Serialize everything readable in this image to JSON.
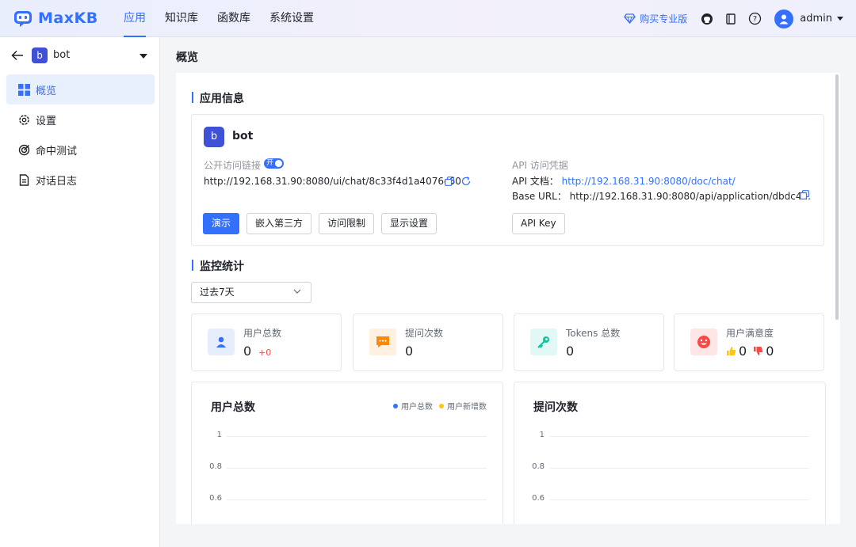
{
  "brand": {
    "name": "MaxKB",
    "color": "#3370ff"
  },
  "nav": {
    "items": [
      "应用",
      "知识库",
      "函数库",
      "系统设置"
    ],
    "active": "应用"
  },
  "header": {
    "buy_label": "购买专业版",
    "user": "admin"
  },
  "sidebar": {
    "app_badge": "b",
    "app_name": "bot",
    "items": [
      {
        "label": "概览",
        "icon": "grid-icon"
      },
      {
        "label": "设置",
        "icon": "gear-icon"
      },
      {
        "label": "命中测试",
        "icon": "target-icon"
      },
      {
        "label": "对话日志",
        "icon": "document-icon"
      }
    ]
  },
  "main": {
    "page_title": "概览",
    "app_info": {
      "section_title": "应用信息",
      "badge": "b",
      "name": "bot",
      "public_link_label": "公开访问链接",
      "toggle_label": "开",
      "public_link": "http://192.168.31.90:8080/ui/chat/8c33f4d1a4076c60",
      "buttons": [
        "演示",
        "嵌入第三方",
        "访问限制",
        "显示设置"
      ],
      "api_title": "API 访问凭据",
      "api_doc_label": "API 文档：",
      "api_doc_url": "http://192.168.31.90:8080/doc/chat/",
      "base_url_label": "Base URL：",
      "base_url": "http://192.168.31.90:8080/api/application/dbdc4...",
      "api_key_button": "API Key"
    },
    "monitor": {
      "section_title": "监控统计",
      "range_select": "过去7天",
      "stats": [
        {
          "label": "用户总数",
          "value": "0",
          "delta": "+0",
          "icon": "user-icon",
          "color": "#3370ff"
        },
        {
          "label": "提问次数",
          "value": "0",
          "icon": "chat-icon",
          "color": "#ff8800"
        },
        {
          "label": "Tokens 总数",
          "value": "0",
          "icon": "key-icon",
          "color": "#14c0a8"
        },
        {
          "label": "用户满意度",
          "likes": "0",
          "dislikes": "0",
          "icon": "smile-icon",
          "color": "#f54a45"
        }
      ]
    },
    "charts": [
      {
        "title": "用户总数",
        "legend": [
          {
            "name": "用户总数",
            "color": "#3370ff"
          },
          {
            "name": "用户新增数",
            "color": "#ffc60a"
          }
        ],
        "ticks": [
          "1",
          "0.8",
          "0.6"
        ]
      },
      {
        "title": "提问次数",
        "ticks": [
          "1",
          "0.8",
          "0.6"
        ]
      }
    ]
  }
}
